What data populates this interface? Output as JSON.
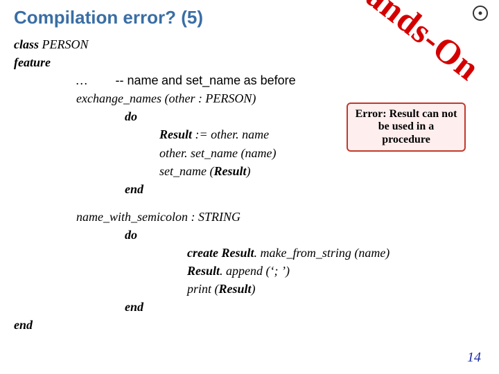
{
  "title": "Compilation error? (5)",
  "stamp": "Hands-On",
  "callout": "Error: Result can not be used in a procedure",
  "page_number": "14",
  "icons": {
    "logo": "eth-logo-circle"
  },
  "code": {
    "kw_class": "class",
    "class_name": "PERSON",
    "kw_feature": "feature",
    "ellipsis": "…",
    "comment": "-- name and set_name as before",
    "proc1_name": "exchange_names",
    "proc1_sig_open": " (other : PERSON)",
    "kw_do_1": "do",
    "stmt1a": "Result",
    "stmt1b": " := other. name",
    "stmt2": "other. set_name (name)",
    "stmt3a": "set_name (",
    "stmt3b": "Result",
    "stmt3c": ")",
    "kw_end_1": "end",
    "func_name": "name_with_semicolon : STRING",
    "kw_do_2": "do",
    "stmt4a": "create Result",
    "stmt4b": ". make_from_string (name)",
    "stmt5a": "Result",
    "stmt5b": ". append (‘; ’)",
    "stmt6a": "print (",
    "stmt6b": "Result",
    "stmt6c": ")",
    "kw_end_2": "end",
    "kw_end_final": "end"
  }
}
